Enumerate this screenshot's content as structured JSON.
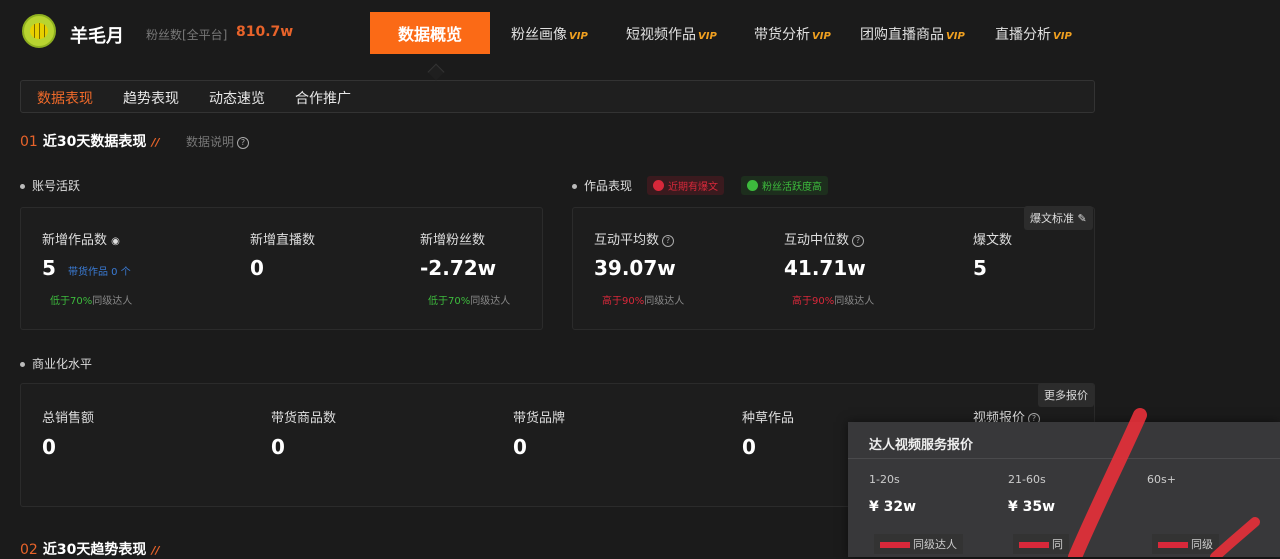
{
  "header": {
    "name": "羊毛月",
    "fans_label": "粉丝数[全平台]",
    "fans_value": "810.7w",
    "active_tab": "数据概览",
    "nav": [
      {
        "label": "粉丝画像",
        "vip": "VIP"
      },
      {
        "label": "短视频作品",
        "vip": "VIP"
      },
      {
        "label": "带货分析",
        "vip": "VIP"
      },
      {
        "label": "团购直播商品",
        "vip": "VIP"
      },
      {
        "label": "直播分析",
        "vip": "VIP"
      }
    ]
  },
  "subtabs": [
    "数据表现",
    "趋势表现",
    "动态速览",
    "合作推广"
  ],
  "section1": {
    "num": "01",
    "title": "近30天数据表现",
    "slash": "//",
    "help": "数据说明"
  },
  "account": {
    "title": "账号活跃",
    "items": [
      {
        "label": "新增作品数",
        "value": "5",
        "extra": "带货作品 0 个",
        "cmp_hl": "低于70%",
        "cmp": "同级达人"
      },
      {
        "label": "新增直播数",
        "value": "0"
      },
      {
        "label": "新增粉丝数",
        "value": "-2.72w",
        "cmp_hl": "低于70%",
        "cmp": "同级达人"
      }
    ]
  },
  "works": {
    "title": "作品表现",
    "badge1": "近期有爆文",
    "badge2": "粉丝活跃度高",
    "std_btn": "爆文标准",
    "items": [
      {
        "label": "互动平均数",
        "value": "39.07w",
        "cmp_hl": "高于90%",
        "cmp": "同级达人"
      },
      {
        "label": "互动中位数",
        "value": "41.71w",
        "cmp_hl": "高于90%",
        "cmp": "同级达人"
      },
      {
        "label": "爆文数",
        "value": "5"
      }
    ]
  },
  "commercial": {
    "title": "商业化水平",
    "more_btn": "更多报价",
    "items": [
      {
        "label": "总销售额",
        "value": "0"
      },
      {
        "label": "带货商品数",
        "value": "0"
      },
      {
        "label": "带货品牌",
        "value": "0"
      },
      {
        "label": "种草作品",
        "value": "0"
      },
      {
        "label": "视频报价"
      }
    ]
  },
  "popup": {
    "title": "达人视频服务报价",
    "cols": [
      {
        "label": "1-20s",
        "price": "¥ 32w",
        "cmp": "同级达人"
      },
      {
        "label": "21-60s",
        "price": "¥ 35w",
        "cmp": "同"
      },
      {
        "label": "60s+",
        "cmp": "同级"
      }
    ]
  },
  "section2": {
    "num": "02",
    "title": "近30天趋势表现",
    "slash": "//"
  }
}
